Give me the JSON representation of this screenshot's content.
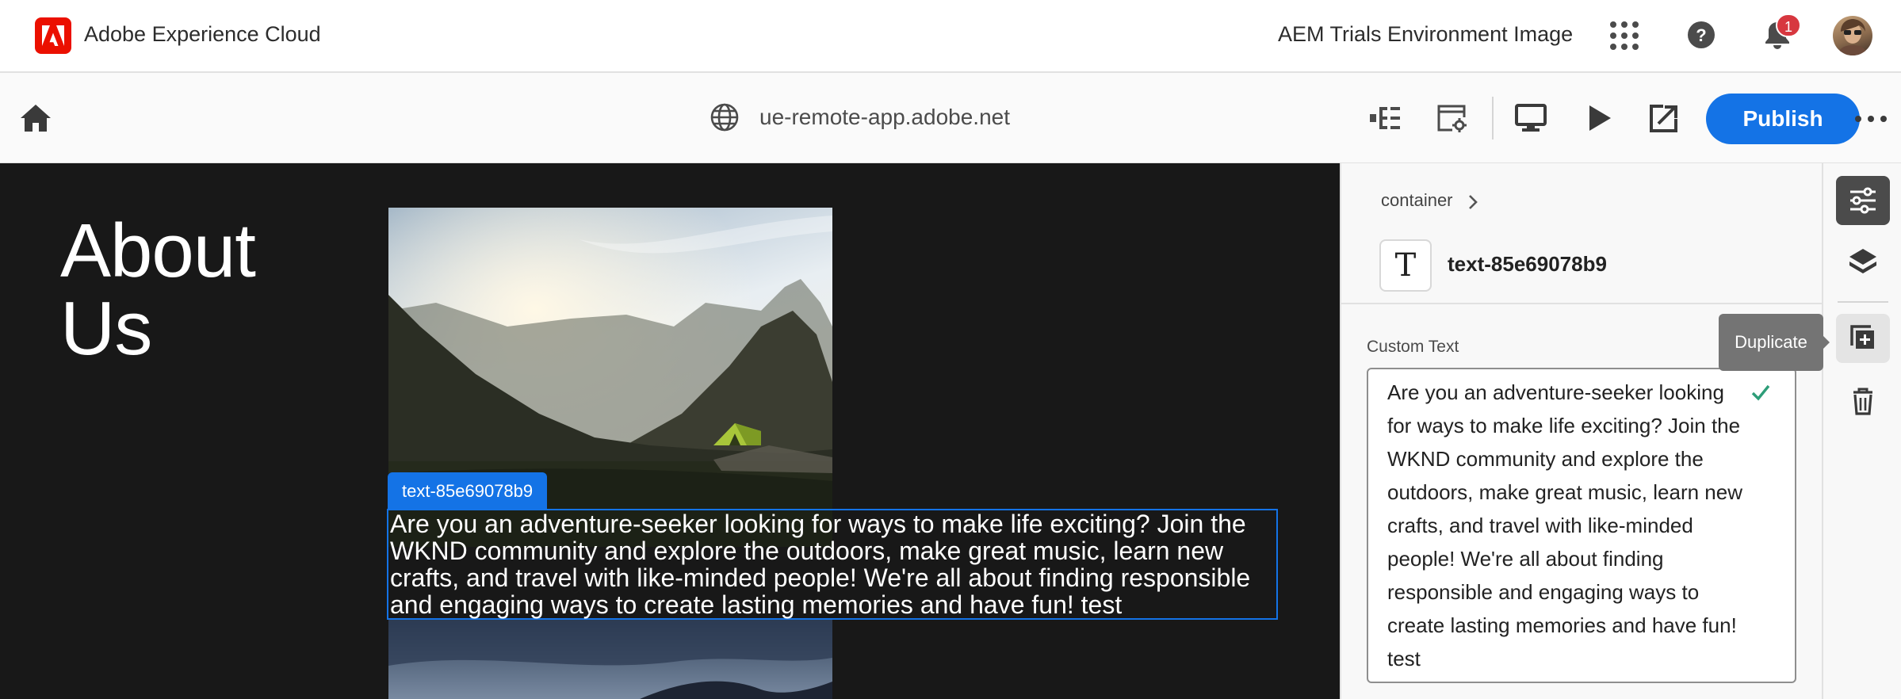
{
  "shell": {
    "product_name": "Adobe Experience Cloud",
    "environment_name": "AEM Trials Environment Image",
    "notification_count": "1",
    "icons": [
      "adobe-logo",
      "apps-grid-icon",
      "help-icon",
      "bell-icon",
      "avatar"
    ]
  },
  "toolbar": {
    "url": "ue-remote-app.adobe.net",
    "publish_label": "Publish",
    "icons": [
      "home-icon",
      "globe-icon",
      "content-tree-icon",
      "page-properties-icon",
      "desktop-icon",
      "preview-icon",
      "open-in-new-icon",
      "more-icon"
    ]
  },
  "canvas": {
    "heading_line1": "About",
    "heading_line2": "Us",
    "selection_label": "text-85e69078b9",
    "selected_text": "Are you an adventure-seeker looking for ways to make life exciting? Join the WKND community and explore the outdoors, make great music, learn new crafts, and travel with like-minded people! We're all about finding responsible and engaging ways to create lasting memories and have fun! test"
  },
  "panel": {
    "breadcrumb": "container",
    "component_icon_glyph": "T",
    "component_name": "text-85e69078b9",
    "field_label": "Custom Text",
    "field_value": "Are you an adventure-seeker looking for ways to make life exciting? Join the WKND community and explore the outdoors, make great music, learn new crafts, and travel with like-minded people! We're all about finding responsible and engaging ways to create lasting memories and have fun! test"
  },
  "rail": {
    "tooltip": "Duplicate",
    "items": [
      "properties-icon",
      "layers-icon",
      "duplicate-icon",
      "delete-icon"
    ]
  },
  "colors": {
    "accent": "#1473e6",
    "adobe_red": "#eb1000",
    "canvas_bg": "#181818",
    "badge_red": "#d7373f",
    "success_green": "#2d9d78"
  }
}
